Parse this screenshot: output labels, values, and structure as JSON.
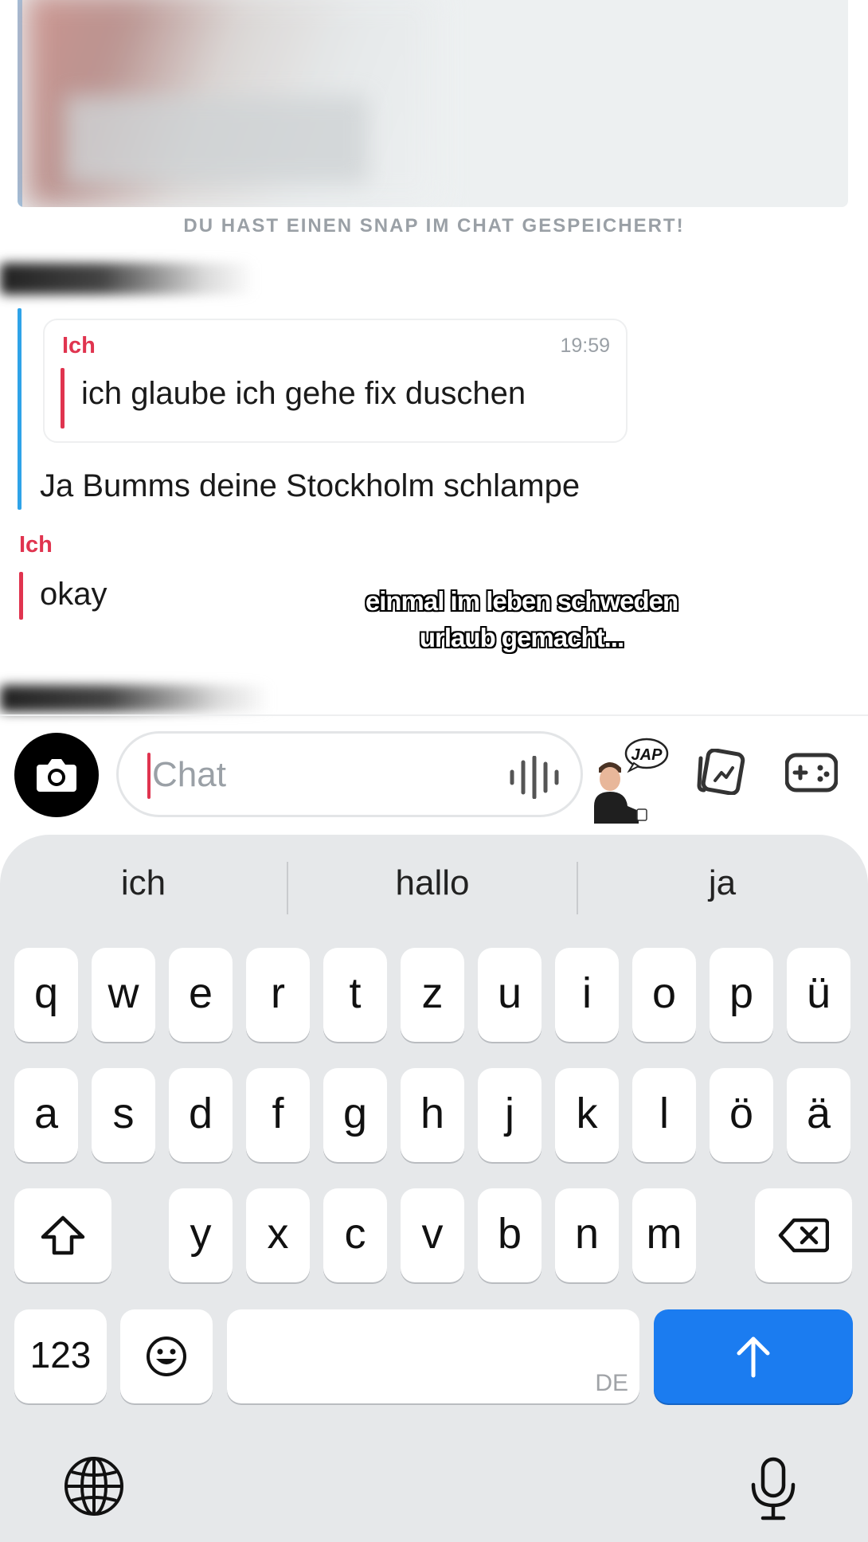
{
  "chat": {
    "saved_banner": "DU HAST EINEN SNAP IM CHAT GESPEICHERT!",
    "quote": {
      "author": "Ich",
      "time": "19:59",
      "text": "ich glaube ich gehe fix duschen"
    },
    "reply_text": "Ja Bumms deine Stockholm schlampe",
    "my_message": {
      "author": "Ich",
      "text": "okay"
    },
    "caption_line1": "einmal im leben schweden",
    "caption_line2": "urlaub gemacht..."
  },
  "input": {
    "placeholder": "Chat",
    "bitmoji_label": "JAP"
  },
  "keyboard": {
    "suggestions": [
      "ich",
      "hallo",
      "ja"
    ],
    "row1": [
      "q",
      "w",
      "e",
      "r",
      "t",
      "z",
      "u",
      "i",
      "o",
      "p",
      "ü"
    ],
    "row2": [
      "a",
      "s",
      "d",
      "f",
      "g",
      "h",
      "j",
      "k",
      "l",
      "ö",
      "ä"
    ],
    "row3": [
      "y",
      "x",
      "c",
      "v",
      "b",
      "n",
      "m"
    ],
    "numbers_label": "123",
    "space_language": "DE"
  },
  "colors": {
    "accent_red": "#e0344f",
    "accent_blue": "#2fa3e8",
    "send_blue": "#1b7cf0"
  },
  "icons": [
    "camera-icon",
    "voice-wave-icon",
    "media-icon",
    "game-controller-icon",
    "shift-icon",
    "backspace-icon",
    "emoji-icon",
    "send-arrow-icon",
    "globe-icon",
    "microphone-icon"
  ]
}
